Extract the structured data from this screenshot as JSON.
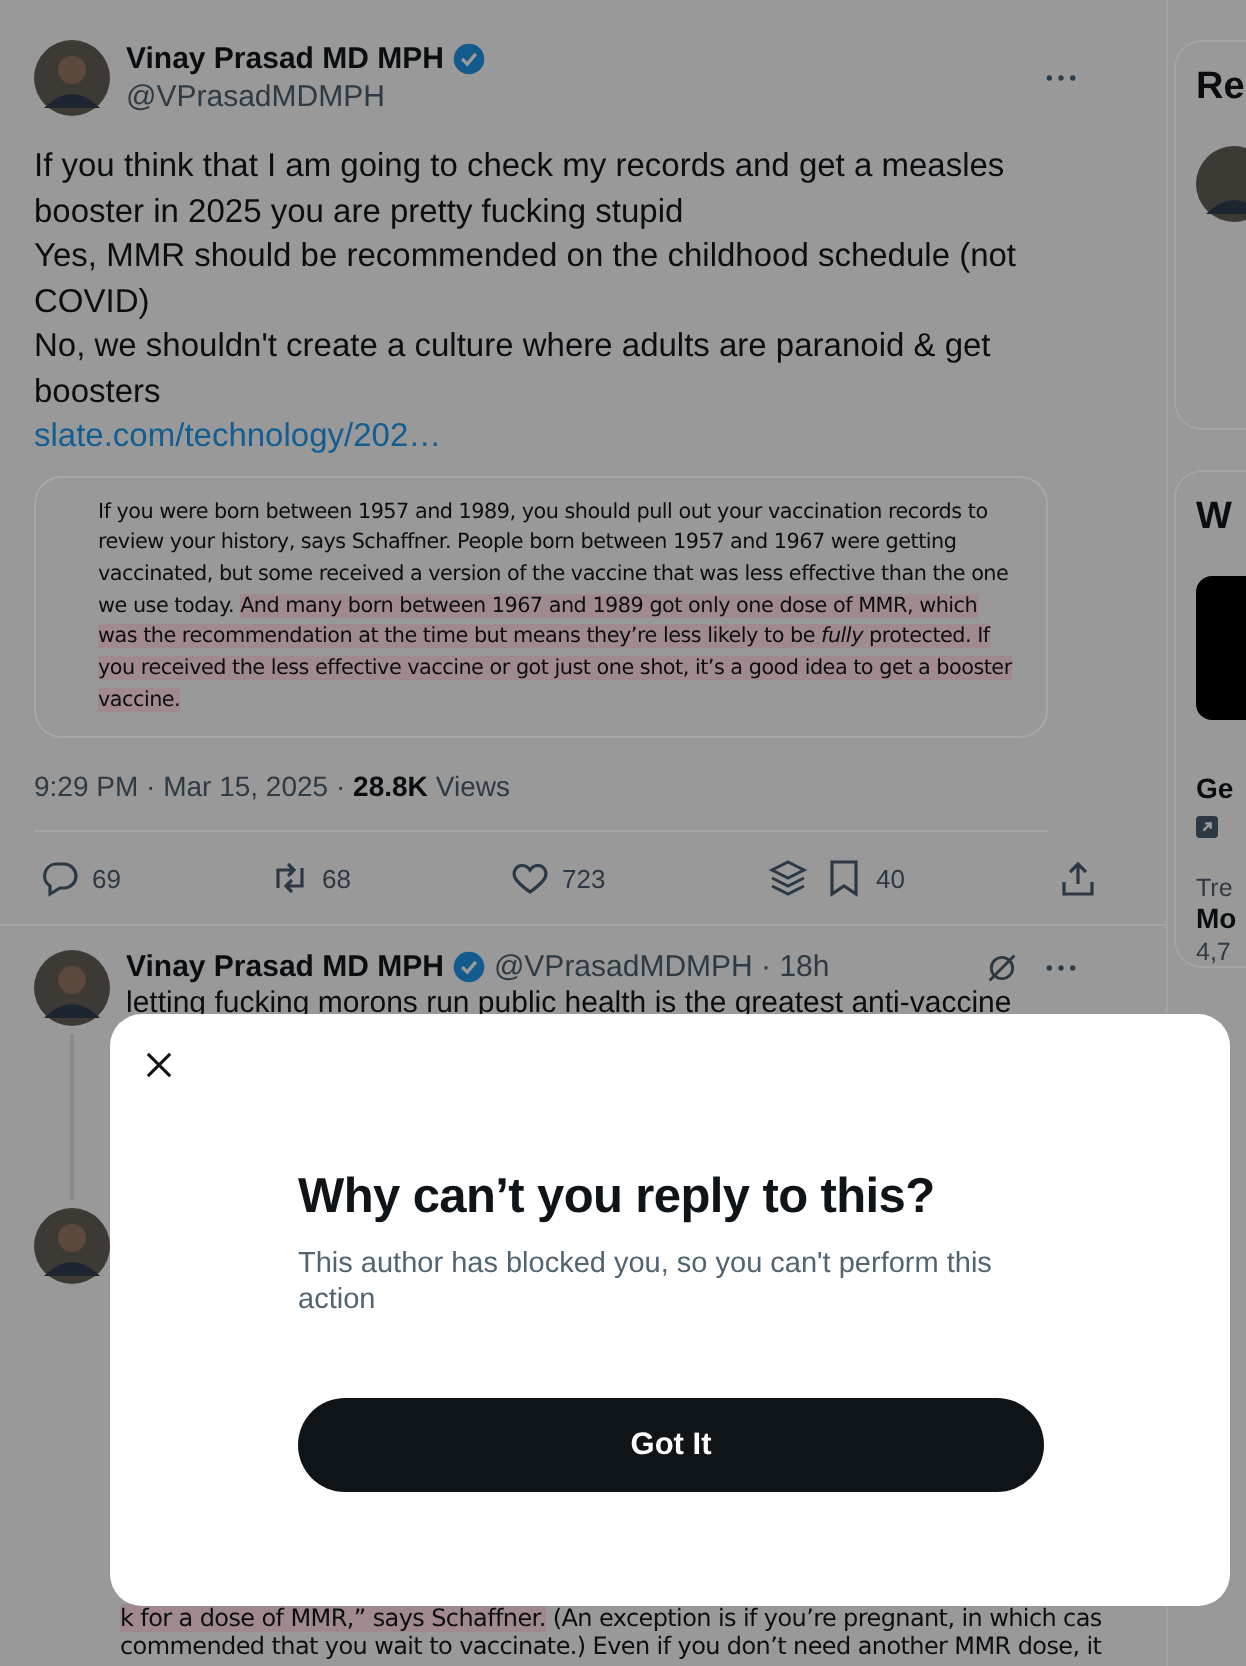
{
  "tweet": {
    "author": {
      "name": "Vinay Prasad MD MPH",
      "handle": "@VPrasadMDMPH",
      "verified": true
    },
    "text": "If you think that I am going to check my records and get a measles booster in 2025 you are pretty fucking stupid\nYes, MMR should be recommended on the childhood schedule (not COVID)\nNo, we shouldn't create a culture where adults are paranoid & get boosters",
    "link": "slate.com/technology/202…",
    "quote": [
      {
        "text": "If you were born between 1957 and 1989, you should pull out your vaccination records to review your history, says Schaffner. People born between 1957 and 1967 were getting vaccinated, but some received a version of the vaccine that was less effective than the one we use today. ",
        "highlighted": false
      },
      {
        "text": "And many born between 1967 and 1989 got only one dose of MMR, which was the recommendation at the time but means they’re less likely to be *fully* protected. If you received the less effective vaccine or got just one shot, it’s a good idea to get a booster vaccine.",
        "highlighted": true
      }
    ],
    "time": "9:29 PM · Mar 15, 2025 · ",
    "views_count": "28.8K",
    "views_label": "Views",
    "actions": [
      {
        "kind": "reply",
        "count": "69"
      },
      {
        "kind": "repost",
        "count": "68"
      },
      {
        "kind": "like",
        "count": "723"
      },
      {
        "kind": "layers"
      },
      {
        "kind": "bookmark",
        "count": "40"
      },
      {
        "kind": "share"
      }
    ]
  },
  "reply": {
    "author": {
      "name": "Vinay Prasad MD MPH",
      "handle": "@VPrasadMDMPH · 18h",
      "verified": true
    },
    "text": "letting fucking morons run public health is the greatest anti-vaccine"
  },
  "third": {
    "quote_lines": [
      [
        {
          "text": "k for a dose of MMR,” says Schaffner.",
          "highlighted": true
        },
        {
          "text": " (An exception is if you’re pregnant, in which cas",
          "highlighted": false
        }
      ],
      [
        {
          "text": "commended that you wait to vaccinate.) Even if you don’t need another MMR dose, it",
          "highlighted": false
        }
      ]
    ]
  },
  "sidebar": {
    "card_1_title": "Re",
    "card_2_title": "W",
    "items": [
      {
        "kind": "headline",
        "text": "Ge"
      },
      {
        "kind": "context",
        "text": "Tre"
      },
      {
        "kind": "topic",
        "text": "Mo"
      },
      {
        "kind": "count",
        "text": "4,7"
      }
    ]
  },
  "dialog": {
    "title": "Why can’t you reply to this?",
    "message": "This author has blocked you, so you can't perform this action",
    "button": "Got It"
  }
}
